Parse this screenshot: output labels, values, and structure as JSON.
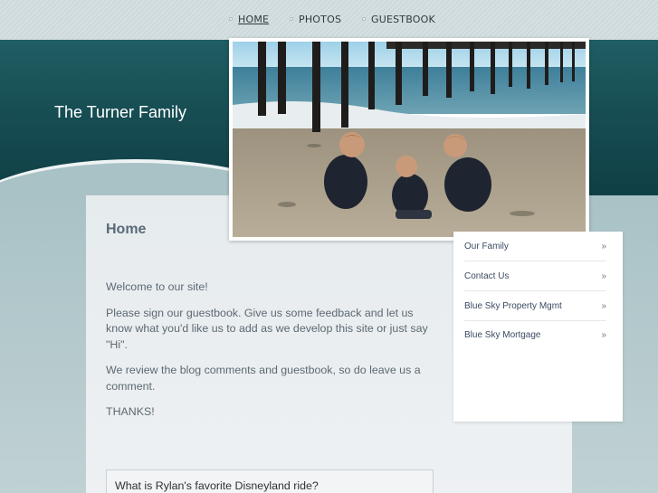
{
  "nav": {
    "items": [
      {
        "label": "HOME",
        "active": true
      },
      {
        "label": "PHOTOS",
        "active": false
      },
      {
        "label": "GUESTBOOK",
        "active": false
      }
    ]
  },
  "header": {
    "site_title": "The Turner Family"
  },
  "main": {
    "heading": "Home",
    "paragraphs": [
      "Welcome to our site!",
      "Please sign our guestbook.  Give us some feedback and let us know what you'd like us to add as we develop this site or just say \"Hi\".",
      "We review the blog comments and guestbook, so do leave us a comment.",
      "THANKS!"
    ],
    "question": "What is Rylan's favorite Disneyland ride?"
  },
  "sidebar": {
    "items": [
      {
        "label": "Our Family",
        "chevron": "»"
      },
      {
        "label": "Contact Us",
        "chevron": "»"
      },
      {
        "label": "Blue Sky Property Mgmt",
        "chevron": "»"
      },
      {
        "label": "Blue Sky Mortgage",
        "chevron": "»"
      }
    ]
  },
  "colors": {
    "header_teal": "#174e54",
    "link": "#3b4b63",
    "text": "#5d6972"
  },
  "icons": {
    "nav_bullet": "dot-icon",
    "sidebar_arrow": "double-chevron-right-icon"
  }
}
